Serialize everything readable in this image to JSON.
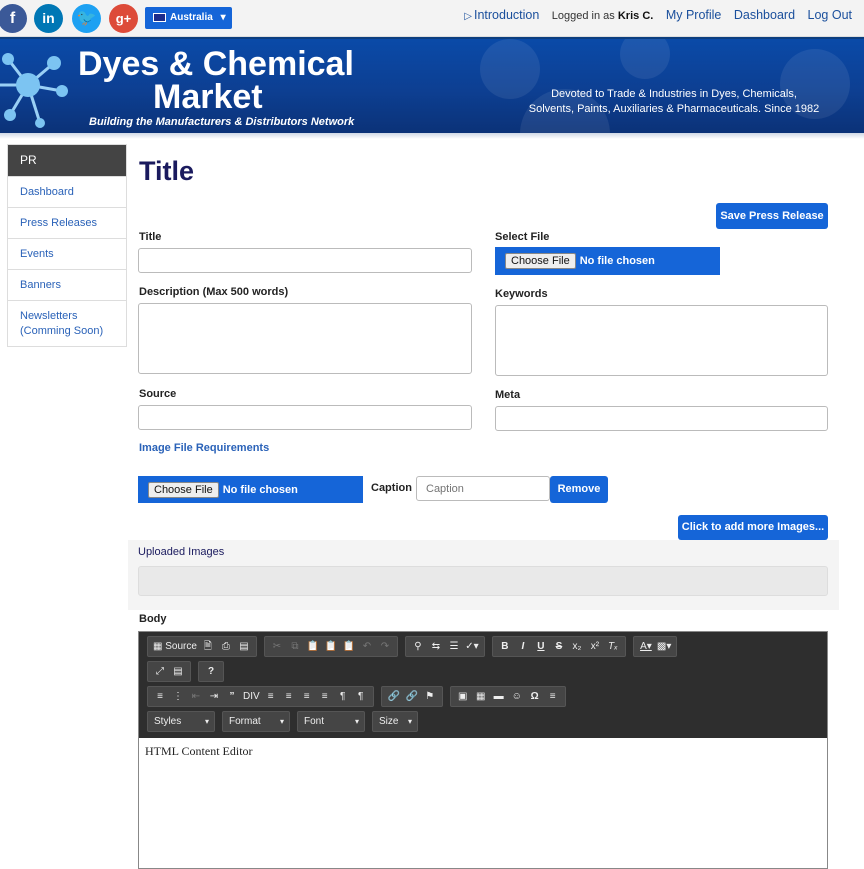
{
  "topbar": {
    "country": "Australia",
    "nav": {
      "intro": "Introduction",
      "logged_prefix": "Logged in as ",
      "user": "Kris C.",
      "profile": "My Profile",
      "dashboard": "Dashboard",
      "logout": "Log Out"
    }
  },
  "banner": {
    "title1": "Dyes & Chemical",
    "title2": "Market",
    "tagline": "Building the Manufacturers & Distributors Network",
    "devoted1": "Devoted to Trade & Industries in Dyes, Chemicals,",
    "devoted2": "Solvents, Paints, Auxiliaries & Pharmaceuticals. Since 1982"
  },
  "sidebar": {
    "head": "PR",
    "items": [
      "Dashboard",
      "Press Releases",
      "Events",
      "Banners",
      "Newsletters",
      "(Comming Soon)"
    ]
  },
  "main": {
    "title": "Title",
    "save": "Save Press Release",
    "title_label": "Title",
    "select_file": "Select File",
    "choose_file": "Choose File",
    "no_file": "No file chosen",
    "description": "Description (Max 500 words)",
    "keywords": "Keywords",
    "source": "Source",
    "meta": "Meta",
    "img_req": "Image File Requirements",
    "caption_label": "Caption",
    "caption_placeholder": "Caption",
    "remove": "Remove",
    "add_more": "Click to add more Images...",
    "uploaded": "Uploaded Images",
    "body": "Body"
  },
  "editor": {
    "source": "Source",
    "styles": "Styles",
    "format": "Format",
    "font": "Font",
    "size": "Size",
    "content": "HTML Content Editor"
  }
}
